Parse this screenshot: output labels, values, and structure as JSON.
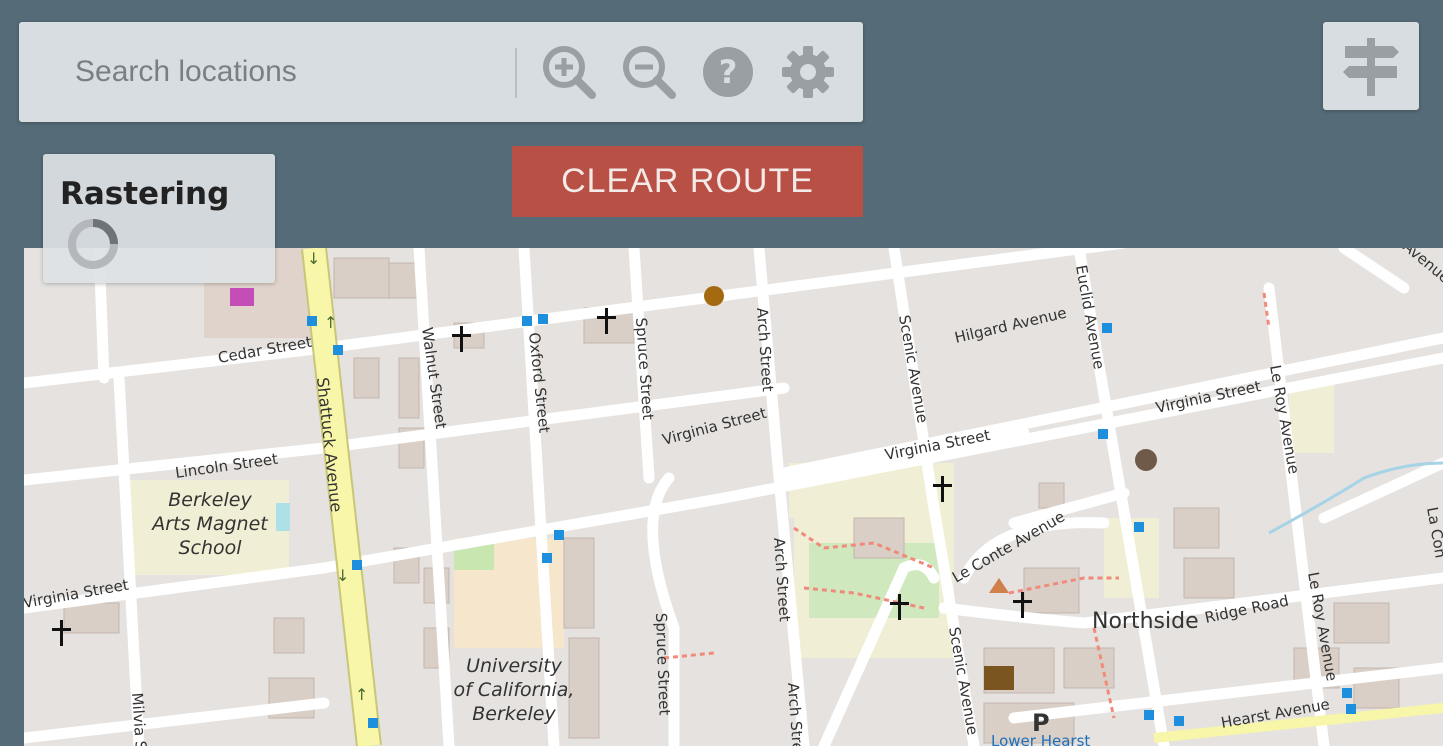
{
  "search": {
    "placeholder": "Search locations"
  },
  "toolbar": {
    "zoom_in": "zoom-in-icon",
    "zoom_out": "zoom-out-icon",
    "help": "help-icon",
    "settings": "gear-icon"
  },
  "directions": {
    "icon": "signpost-icon"
  },
  "route": {
    "clear_label": "CLEAR ROUTE"
  },
  "status": {
    "title": "Rastering"
  },
  "colors": {
    "background": "#556c78",
    "panel": "#d7dde1",
    "clear_button": "#b85046",
    "icon_gray": "#9a9fa3",
    "major_road": "#f7f6a9",
    "poi_blue": "#1e8fdc"
  },
  "map": {
    "streets": {
      "cedar": "Cedar Street",
      "walnut": "Walnut Street",
      "oxford": "Oxford Street",
      "spruce_north": "Spruce Street",
      "arch_north": "Arch Street",
      "scenic_north": "Scenic Avenue",
      "hilgard": "Hilgard Avenue",
      "euclid": "Euclid Avenue",
      "shattuck": "Shattuck Avenue",
      "virginia_curve": "Virginia Street",
      "virginia_mid": "Virginia Street",
      "virginia_east": "Virginia Street",
      "le_roy_north": "Le Roy Avenue",
      "lincoln": "Lincoln Street",
      "virginia_west": "Virginia Street",
      "le_conte": "Le Conte Avenue",
      "arch_south": "Arch Street",
      "ridge": "Ridge Road",
      "le_roy_south": "Le Roy Avenue",
      "spruce_south": "Spruce Street",
      "scenic_south": "Scenic Avenue",
      "hearst": "Hearst Avenue",
      "milvia": "Milvia S",
      "arch_bottom": "Arch Stre",
      "avenue_corner": "Avenue",
      "la_con": "La Con",
      "lower_hearst": "Lower Hearst"
    },
    "places": {
      "school_line1": "Berkeley",
      "school_line2": "Arts Magnet",
      "school_line3": "School",
      "uc_line1": "University",
      "uc_line2": "of California,",
      "uc_line3": "Berkeley",
      "northside": "Northside",
      "parking": "P"
    }
  }
}
